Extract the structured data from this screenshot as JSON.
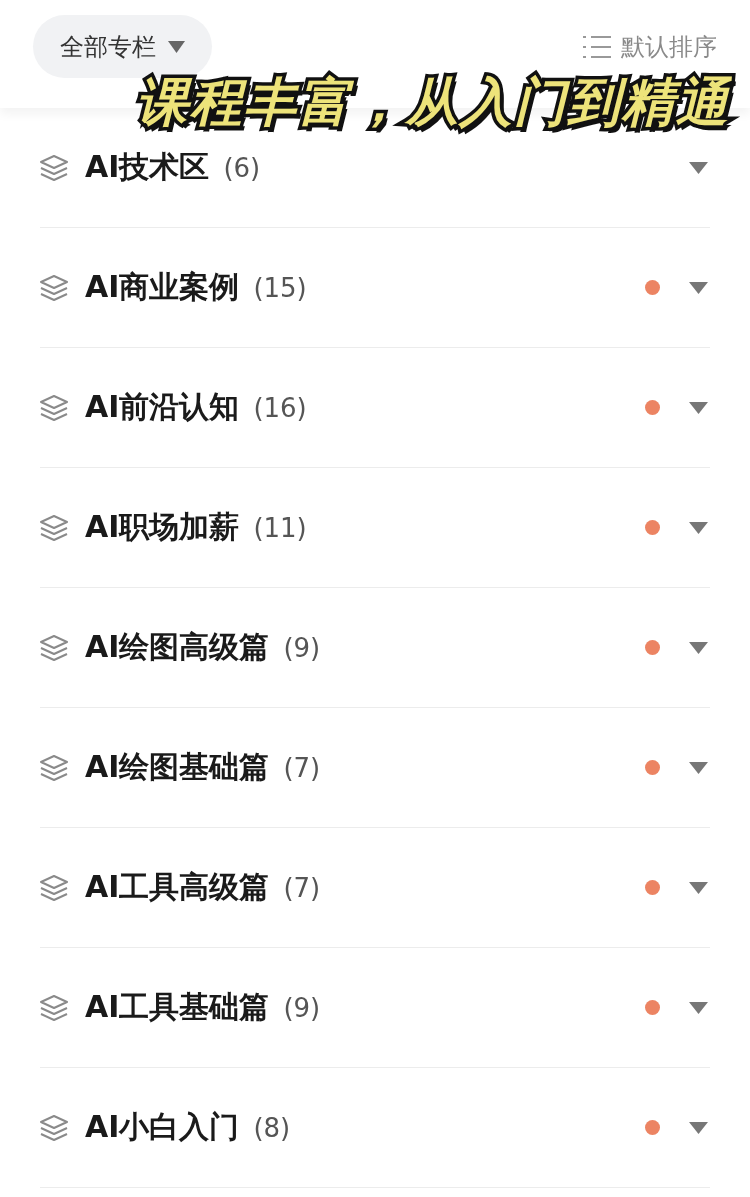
{
  "filter": {
    "label": "全部专栏"
  },
  "sort": {
    "label": "默认排序"
  },
  "caption": "课程丰富，从入门到精通",
  "sections": [
    {
      "title": "AI技术区",
      "count": "(6)",
      "has_update": false,
      "expanded": false
    },
    {
      "title": "AI商业案例",
      "count": "(15)",
      "has_update": true,
      "expanded": false
    },
    {
      "title": "AI前沿认知",
      "count": "(16)",
      "has_update": true,
      "expanded": false
    },
    {
      "title": "AI职场加薪",
      "count": "(11)",
      "has_update": true,
      "expanded": false
    },
    {
      "title": "AI绘图高级篇",
      "count": "(9)",
      "has_update": true,
      "expanded": false
    },
    {
      "title": "AI绘图基础篇",
      "count": "(7)",
      "has_update": true,
      "expanded": false
    },
    {
      "title": "AI工具高级篇",
      "count": "(7)",
      "has_update": true,
      "expanded": false
    },
    {
      "title": "AI工具基础篇",
      "count": "(9)",
      "has_update": true,
      "expanded": false
    },
    {
      "title": "AI小白入门",
      "count": "(8)",
      "has_update": true,
      "expanded": false
    }
  ]
}
